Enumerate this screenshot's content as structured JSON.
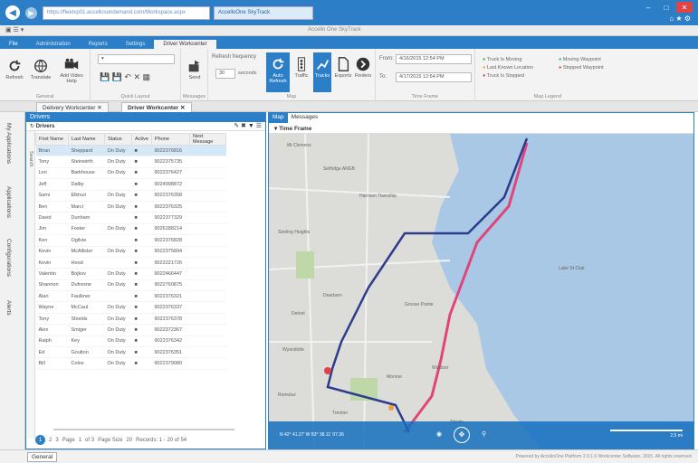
{
  "browser": {
    "address": "https://fleetxp01.accellosondemand.com/Workspace.aspx",
    "tab_title": "AccelloOne SkyTrack"
  },
  "app": {
    "title": "Accello One SkyTrack"
  },
  "ribbon_tabs": [
    "File",
    "Administration",
    "Reports",
    "Settings",
    "Driver Workcenter"
  ],
  "ribbon": {
    "refresh": "Refresh",
    "translate": "Translate",
    "video_help": "Add Video Help",
    "general": "General",
    "quick_layout": "Quick Layout",
    "messages": "Messages",
    "send": "Send",
    "refresh_frequency": "Refresh frequency",
    "freq_value": "30",
    "seconds": "seconds",
    "auto_refresh": "Auto Refresh",
    "traffic": "Traffic",
    "tracks": "Tracks",
    "exports": "Exports",
    "finders": "Finders",
    "map": "Map",
    "from_label": "From:",
    "from_value": "4/16/2015 12:54 PM",
    "to_label": "To:",
    "to_value": "4/17/2015 12:54 PM",
    "time_frame": "Time Frame",
    "legend": {
      "moving": "Truck Is Moving",
      "last_location": "Last Known Location",
      "stopped": "Truck Is Stopped",
      "moving_waypoint": "Moving Waypoint",
      "stopped_waypoint": "Stopped Waypoint",
      "title": "Map Legend"
    }
  },
  "doc_tabs": [
    "Delivery Workcenter",
    "Driver Workcenter"
  ],
  "rail": [
    "My Applications",
    "Applications",
    "Configurations",
    "Alerts"
  ],
  "drivers": {
    "title": "Drivers",
    "subtitle": "Drivers",
    "search": "Search",
    "columns": [
      "First Name",
      "Last Name",
      "Status",
      "Active",
      "Phone",
      "Next Message"
    ],
    "rows": [
      [
        "Brian",
        "Sheppard",
        "On Duty",
        "9022376816"
      ],
      [
        "Tony",
        "Steinwirth",
        "On Duty",
        "9022375735"
      ],
      [
        "Lori",
        "Barkhouse",
        "On Duty",
        "9022376427"
      ],
      [
        "Jeff",
        "Dalby",
        "",
        "9024998872"
      ],
      [
        "Sami",
        "Elkhuri",
        "On Duty",
        "9022376358"
      ],
      [
        "Ben",
        "Marci",
        "On Duty",
        "9022376325"
      ],
      [
        "David",
        "Dunham",
        "",
        "9022377329"
      ],
      [
        "Jim",
        "Foster",
        "On Duty",
        "9026188214"
      ],
      [
        "Ken",
        "Ogilvie",
        "",
        "9022376828"
      ],
      [
        "Kevin",
        "McAllister",
        "On Duty",
        "9022375894"
      ],
      [
        "Kevin",
        "Hood",
        "",
        "9022221726"
      ],
      [
        "Valentin",
        "Bojkov",
        "On Duty",
        "9022466447"
      ],
      [
        "Shannon",
        "Dufresne",
        "On Duty",
        "9022760875"
      ],
      [
        "Alan",
        "Faulkner",
        "",
        "9022376321"
      ],
      [
        "Wayne",
        "McCaul",
        "On Duty",
        "9022376337"
      ],
      [
        "Tony",
        "Shields",
        "On Duty",
        "9022376378"
      ],
      [
        "Alex",
        "Smiger",
        "On Duty",
        "9022372367"
      ],
      [
        "Ralph",
        "Key",
        "On Duty",
        "9022376342"
      ],
      [
        "Ed",
        "Goulton",
        "On Duty",
        "9022376351"
      ],
      [
        "Bill",
        "Coles",
        "On Duty",
        "9022379080"
      ]
    ],
    "pager": {
      "pages": [
        "1",
        "2",
        "3"
      ],
      "page_label": "Page",
      "page_value": "1",
      "of": "of 3",
      "page_size_label": "Page Size",
      "page_size": "20",
      "records": "Records: 1 - 20 of 54"
    }
  },
  "map": {
    "tabs": [
      "Map",
      "Messages"
    ],
    "time_frame": "Time Frame",
    "labels": [
      "Mt Clemens",
      "Selfridge ANGB",
      "Harrison Township",
      "Grosse Pointe",
      "Detroit",
      "Windsor",
      "Lake St Clair",
      "Wyandotte",
      "Trenton",
      "Monroe",
      "Toledo",
      "Sterling Heights",
      "Dearborn",
      "Romulus"
    ],
    "coords": "N 42° 41.27' W 83° 38.11' 07.36",
    "scale": "2.5 mi"
  },
  "status": {
    "tab": "General",
    "powered": "Powered by AccelloOne Platform 2.9.1.6 Workcenter Software, 2015. All rights reserved."
  }
}
